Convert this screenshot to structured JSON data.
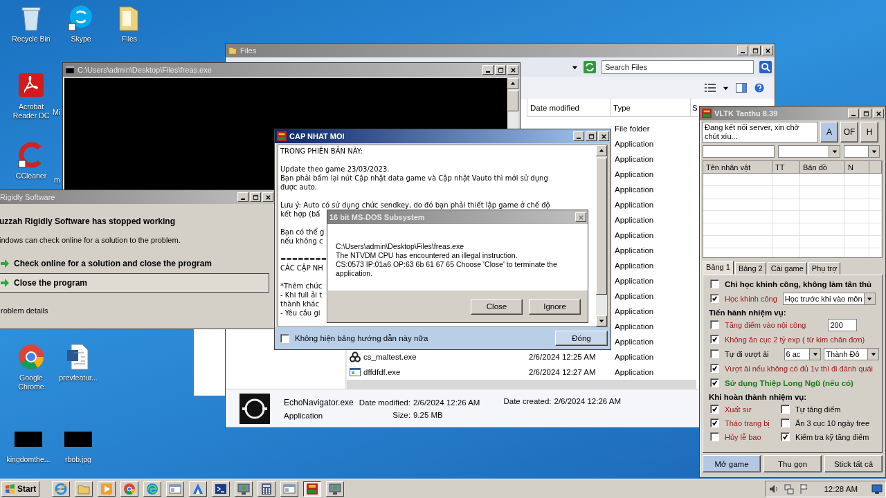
{
  "desktop": {
    "icons": [
      {
        "label": "Recycle Bin",
        "kind": "bin"
      },
      {
        "label": "Skype",
        "kind": "skype"
      },
      {
        "label": "Files",
        "kind": "folder"
      },
      {
        "label": "Acrobat Reader DC",
        "kind": "acrobat"
      },
      {
        "label": "Mi",
        "kind": "partial"
      },
      {
        "label": "CCleaner",
        "kind": "ccleaner"
      },
      {
        "label": "m",
        "kind": "partial"
      },
      {
        "label": "Google Chrome",
        "kind": "chrome"
      },
      {
        "label": "prevfeatur...",
        "kind": "doc"
      },
      {
        "label": "kingdomthe...",
        "kind": "black"
      },
      {
        "label": "rbob.jpg",
        "kind": "black"
      }
    ]
  },
  "explorer": {
    "title": "Files",
    "search": {
      "placeholder": "Search Files"
    },
    "columns": [
      "Date modified",
      "Type",
      "S"
    ],
    "rows": [
      {
        "type": "File folder"
      },
      {
        "type": "Application"
      },
      {
        "type": "Application"
      },
      {
        "type": "Application"
      },
      {
        "type": "Application"
      },
      {
        "type": "Application"
      },
      {
        "type": "Application"
      },
      {
        "type": "Application"
      },
      {
        "type": "Application"
      },
      {
        "type": "Application"
      },
      {
        "type": "Application"
      },
      {
        "type": "Application"
      },
      {
        "type": "Application"
      },
      {
        "type": "Application"
      },
      {
        "type": "Application"
      },
      {
        "name": "cs_maltest.exe",
        "date": "2/6/2024 12:25 AM",
        "type": "Application",
        "kind": "biohazard"
      },
      {
        "name": "dffdfdf.exe",
        "date": "2/6/2024 12:27 AM",
        "type": "Application",
        "kind": "app"
      }
    ],
    "details": {
      "name": "EchoNavigator.exe",
      "type": "Application",
      "modified_label": "Date modified:",
      "modified": "2/6/2024 12:26 AM",
      "size_label": "Size:",
      "size": "9.25 MB",
      "created_label": "Date created:",
      "created": "2/6/2024 12:26 AM"
    }
  },
  "console": {
    "title": "C:\\Users\\admin\\Desktop\\Files\\freas.exe"
  },
  "crash": {
    "title": "Rigidly Software",
    "heading": "uzzah Rigidly Software has stopped working",
    "message": "indows can check online for a solution to the problem.",
    "options": [
      {
        "label": "Check online for a solution and close the program",
        "selected": false
      },
      {
        "label": "Close the program",
        "selected": true
      }
    ],
    "details": "roblem details"
  },
  "update": {
    "title": "CAP NHAT MOI",
    "paragraphs": [
      [
        "TRONG PHIÊN BẢN NÀY:"
      ],
      [
        "Update theo game 23/03/2023.",
        "Bạn phải bấm lại nút Cập nhật data game và Cập nhật Vauto thì mới sử dụng",
        "được auto."
      ],
      [
        "Lưu ý: Auto có sử dụng chức sendkey, do đó bạn phải thiết lập game ở chế độ",
        "kết hợp (bấ"
      ],
      [
        "Bạn có thể g",
        "nếu không c"
      ],
      [
        "========",
        "CÁC CẬP NH"
      ],
      [
        "*Thêm chức",
        "- Khi full ải t",
        "thành khác",
        "- Yêu cầu gi"
      ]
    ],
    "dont_show": {
      "label": "Không hiện bảng hướng dẫn này nữa",
      "checked": false
    },
    "close_button": "Đóng"
  },
  "dos": {
    "title": "16 bit MS-DOS Subsystem",
    "lines": [
      "C:\\Users\\admin\\Desktop\\Files\\freas.exe",
      "The NTVDM CPU has encountered an illegal instruction.",
      "CS:0573 IP:01a6 OP:63 6b 61 67 65 Choose 'Close' to terminate the application."
    ],
    "buttons": [
      "Close",
      "Ignore"
    ]
  },
  "vltk": {
    "title": "VLTK Tanthu 8.39",
    "status": "Đang kết nối server, xin chờ chút xíu...",
    "mode_buttons": [
      {
        "label": "A",
        "selected": true
      },
      {
        "label": "OF",
        "selected": false
      },
      {
        "label": "H",
        "selected": false
      }
    ],
    "columns": [
      "Tên nhân vật",
      "TT",
      "Bản đồ",
      "N"
    ],
    "tabs": [
      {
        "label": "Bảng 1",
        "selected": true
      },
      {
        "label": "Bảng 2",
        "selected": false
      },
      {
        "label": "Cài game",
        "selected": false
      },
      {
        "label": "Phụ trợ",
        "selected": false
      }
    ],
    "options": [
      {
        "kind": "check",
        "label": "Chỉ học khinh công, không làm tân thủ",
        "checked": false,
        "color": "#000000",
        "bold": true
      },
      {
        "kind": "check",
        "label": "Học khinh công",
        "checked": true,
        "color": "#a01818",
        "bold": false,
        "extras": [
          {
            "kind": "select",
            "value": "Học trước khi vào môn"
          }
        ]
      },
      {
        "kind": "heading",
        "label": "Tiến hành nhiệm vụ:"
      },
      {
        "kind": "check",
        "label": "Tăng điểm vào nội công",
        "checked": false,
        "color": "#a01818",
        "bold": false,
        "extras": [
          {
            "kind": "input",
            "value": "200"
          }
        ]
      },
      {
        "kind": "check",
        "label": "Không ăn cục 2 tỷ exp ( từ kim chân đơn)",
        "checked": true,
        "color": "#a01818",
        "bold": false
      },
      {
        "kind": "check",
        "label": "Tự đi vượt ải",
        "checked": false,
        "color": "#000000",
        "bold": false,
        "extras": [
          {
            "kind": "select",
            "value": "6 ac"
          },
          {
            "kind": "select",
            "value": "Thành Đô"
          }
        ]
      },
      {
        "kind": "check",
        "label": "Vượt ải nếu không có đủ 1v thì đi đánh quái",
        "checked": true,
        "color": "#a01818",
        "bold": false
      },
      {
        "kind": "check",
        "label": "Sử dụng Thiệp Long Ngũ (nếu có)",
        "checked": true,
        "color": "#1a7a1a",
        "bold": true
      },
      {
        "kind": "heading",
        "label": "Khi hoàn thành nhiệm vụ:"
      },
      {
        "kind": "grid",
        "items": [
          {
            "label": "Xuất sư",
            "checked": true,
            "color": "#a01818"
          },
          {
            "label": "Tự tăng điểm",
            "checked": false,
            "color": "#000000"
          },
          {
            "label": "Tháo trang bị",
            "checked": true,
            "color": "#a01818"
          },
          {
            "label": "Ăn 3 cục 10 ngày free",
            "checked": false,
            "color": "#000000"
          },
          {
            "label": "Hủy lễ bao",
            "checked": false,
            "color": "#a01818"
          },
          {
            "label": "Kiểm tra kỹ tăng điểm",
            "checked": true,
            "color": "#000000"
          }
        ]
      }
    ],
    "bottom_buttons": [
      {
        "label": "Mở game",
        "selected": true
      },
      {
        "label": "Thu gọn",
        "selected": false
      },
      {
        "label": "Stick tất cả",
        "selected": false
      }
    ]
  },
  "taskbar": {
    "start": "Start",
    "apps": [
      {
        "kind": "ie",
        "selected": false
      },
      {
        "kind": "folder",
        "selected": false
      },
      {
        "kind": "media",
        "selected": false
      },
      {
        "kind": "chrome",
        "selected": false
      },
      {
        "kind": "edge",
        "selected": false
      },
      {
        "kind": "window",
        "selected": false
      },
      {
        "kind": "azure",
        "selected": false
      },
      {
        "kind": "shell",
        "selected": false
      },
      {
        "kind": "check",
        "selected": false
      },
      {
        "kind": "calc",
        "selected": false
      },
      {
        "kind": "window",
        "selected": false
      },
      {
        "kind": "game",
        "selected": true
      },
      {
        "kind": "check",
        "selected": false
      }
    ],
    "clock": "12:28 AM"
  }
}
